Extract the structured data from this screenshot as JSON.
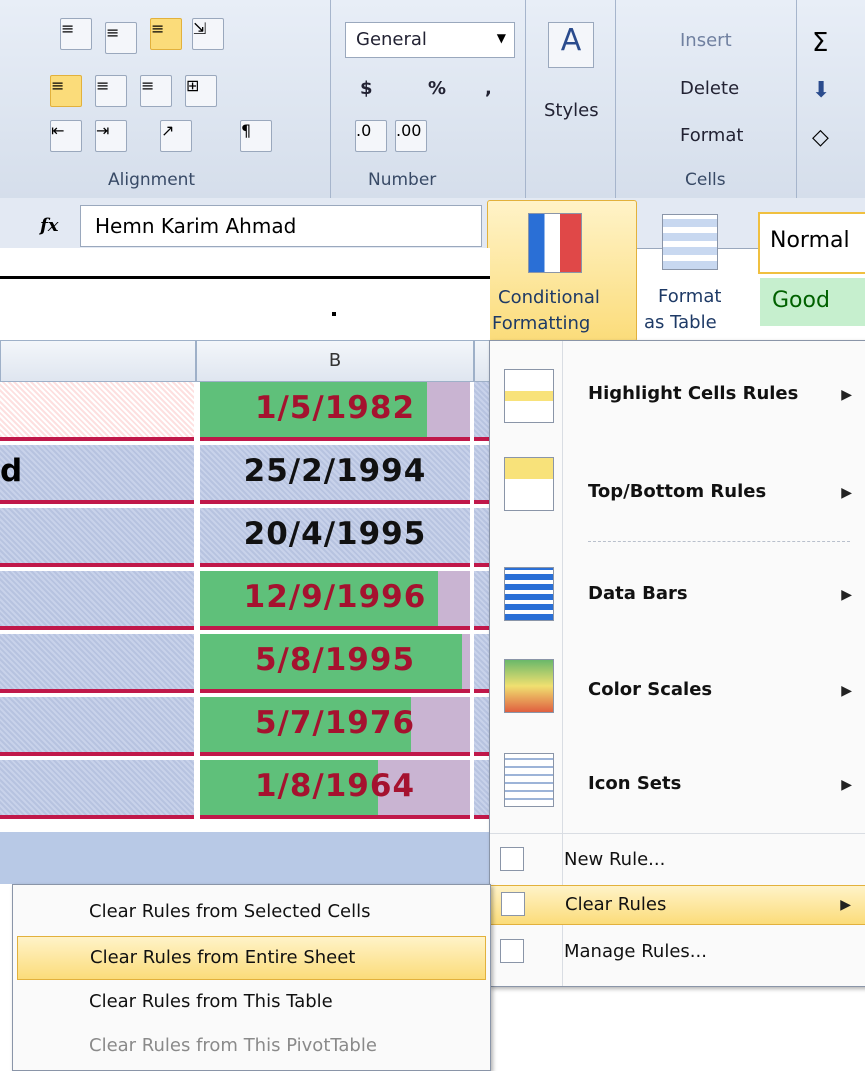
{
  "ribbon": {
    "alignment": {
      "label": "Alignment"
    },
    "number": {
      "label": "Number",
      "format": "General",
      "currency": "$",
      "percent": "%",
      "comma": ","
    },
    "styles": {
      "label": "Styles",
      "cond_fmt_line1": "Conditional",
      "cond_fmt_line2": "Formatting",
      "fmt_table_line1": "Format",
      "fmt_table_line2": "as Table",
      "normal": "Normal",
      "good": "Good"
    },
    "cells": {
      "label": "Cells",
      "insert": "Insert",
      "delete": "Delete",
      "format": "Format"
    }
  },
  "formula_bar": {
    "fx": "fx",
    "value": "Hemn Karim Ahmad"
  },
  "sheet": {
    "column_b": "B",
    "col_a_fragment": "d",
    "rows": [
      {
        "date": "1/5/1982",
        "color": "#a5122f",
        "bar": 0.84
      },
      {
        "date": "25/2/1994",
        "color": "#111111",
        "bar": 0.0
      },
      {
        "date": "20/4/1995",
        "color": "#111111",
        "bar": 0.0
      },
      {
        "date": "12/9/1996",
        "color": "#a5122f",
        "bar": 0.88
      },
      {
        "date": "5/8/1995",
        "color": "#a5122f",
        "bar": 0.97
      },
      {
        "date": "5/7/1976",
        "color": "#a5122f",
        "bar": 0.78
      },
      {
        "date": "1/8/1964",
        "color": "#a5122f",
        "bar": 0.66
      }
    ]
  },
  "menu": {
    "highlight": "Highlight Cells Rules",
    "topbottom": "Top/Bottom Rules",
    "databars": "Data Bars",
    "colorscales": "Color Scales",
    "iconsets": "Icon Sets",
    "newrule": "New Rule...",
    "clearrules": "Clear Rules",
    "managerules": "Manage Rules..."
  },
  "submenu": {
    "selected": "Clear Rules from Selected Cells",
    "entire": "Clear Rules from Entire Sheet",
    "table": "Clear Rules from This Table",
    "pivot": "Clear Rules from This PivotTable"
  },
  "colors": {
    "accent": "#fbdc7a",
    "bar": "#5fc07a",
    "border": "#c0184a"
  }
}
